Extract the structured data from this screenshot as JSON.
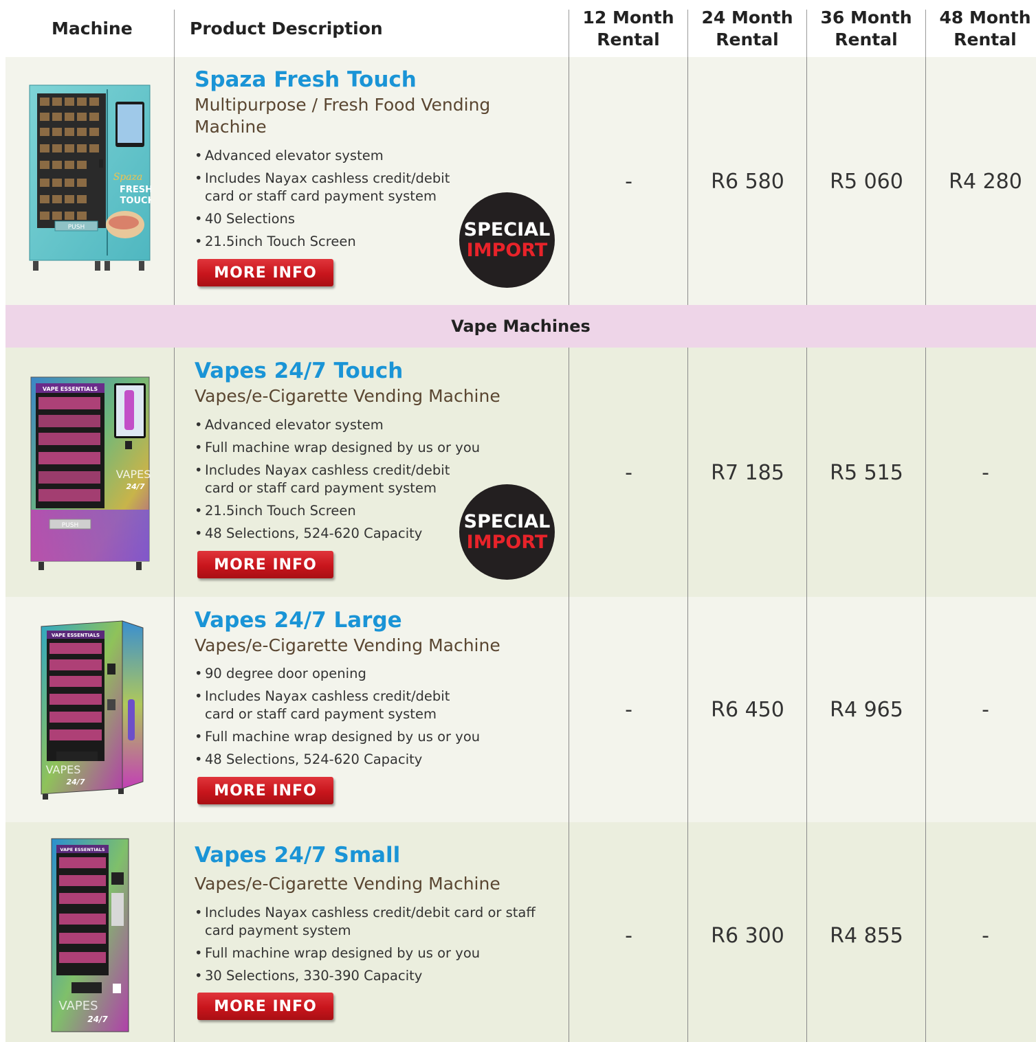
{
  "header": {
    "machine": "Machine",
    "product_description": "Product Description",
    "col12": "12 Month Rental",
    "col24": "24 Month Rental",
    "col36": "36 Month Rental",
    "col48": "48 Month Rental"
  },
  "section_vape": "Vape Machines",
  "badge": {
    "line1": "SPECIAL",
    "line2": "IMPORT"
  },
  "more_info": "MORE INFO",
  "products": [
    {
      "title": "Spaza Fresh Touch",
      "subtitle": "Multipurpose / Fresh Food Vending Machine",
      "bullets": [
        "Advanced elevator system",
        "Includes Nayax cashless credit/debit card or staff card payment system",
        "40 Selections",
        "21.5inch Touch Screen"
      ],
      "prices": [
        "-",
        "R6 580",
        "R5 060",
        "R4 280"
      ],
      "machine_image_text": [
        "Spaza",
        "FRESH",
        "TOUCH",
        "PUSH"
      ]
    },
    {
      "title": "Vapes 24/7 Touch",
      "subtitle": "Vapes/e-Cigarette Vending Machine",
      "bullets": [
        "Advanced elevator system",
        "Full machine wrap designed by us or you",
        "Includes Nayax cashless credit/debit card or staff card payment system",
        "21.5inch Touch Screen",
        "48 Selections, 524-620 Capacity"
      ],
      "prices": [
        "-",
        "R7 185",
        "R5 515",
        "-"
      ],
      "machine_image_text": [
        "VAPE ESSENTIALS",
        "PUSH",
        "VAPES",
        "24/7"
      ]
    },
    {
      "title": "Vapes 24/7 Large",
      "subtitle": "Vapes/e-Cigarette Vending Machine",
      "bullets": [
        "90 degree door opening",
        "Includes Nayax cashless credit/debit card or staff card payment system",
        "Full machine wrap designed by us or you",
        "48 Selections, 524-620 Capacity"
      ],
      "prices": [
        "-",
        "R6 450",
        "R4 965",
        "-"
      ],
      "machine_image_text": [
        "VAPE ESSENTIALS",
        "VAPES",
        "24/7"
      ]
    },
    {
      "title": "Vapes 24/7 Small",
      "subtitle": "Vapes/e-Cigarette Vending Machine",
      "bullets": [
        "Includes Nayax cashless credit/debit card or staff card payment system",
        "Full machine wrap designed by us or you",
        "30 Selections, 330-390 Capacity"
      ],
      "prices": [
        "-",
        "R6 300",
        "R4 855",
        "-"
      ],
      "machine_image_text": [
        "VAPE ESSENTIALS",
        "VAPES",
        "24/7"
      ]
    }
  ],
  "colors": {
    "title_blue": "#1a94d6",
    "subtitle_brown": "#5a4631",
    "button_red": "#c8151c",
    "badge_red": "#e8232a",
    "band_pink": "#eed5e8",
    "row_light": "#f3f4ec",
    "row_dark": "#ebeede"
  }
}
